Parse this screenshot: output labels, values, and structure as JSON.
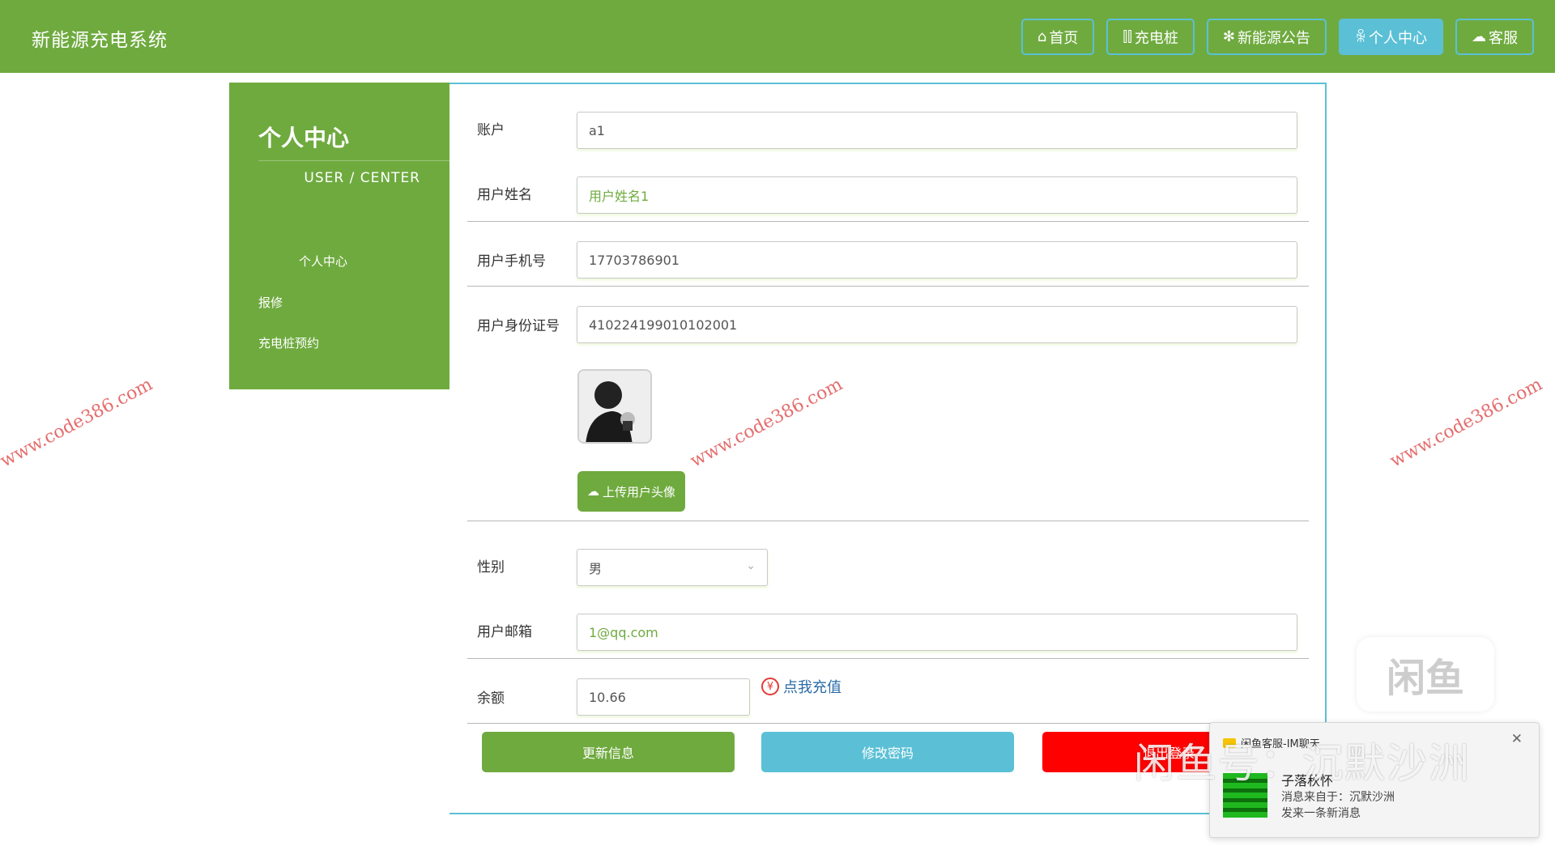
{
  "header": {
    "brand": "新能源充电系统",
    "nav": [
      {
        "icon": "⌂",
        "label": "首页",
        "active": false
      },
      {
        "icon": "⫿⫿",
        "label": "充电桩",
        "active": false
      },
      {
        "icon": "✻",
        "label": "新能源公告",
        "active": false
      },
      {
        "icon": "ꆜ",
        "label": "个人中心",
        "active": true
      },
      {
        "icon": "☁",
        "label": "客服",
        "active": false
      }
    ]
  },
  "sidebar": {
    "title": "个人中心",
    "subtitle": "USER / CENTER",
    "items": [
      "个人中心",
      "报修",
      "充电桩预约"
    ]
  },
  "form": {
    "account_label": "账户",
    "account_value": "a1",
    "name_label": "用户姓名",
    "name_value": "用户姓名1",
    "phone_label": "用户手机号",
    "phone_value": "17703786901",
    "idcard_label": "用户身份证号",
    "idcard_value": "410224199010102001",
    "upload_label": "上传用户头像",
    "gender_label": "性别",
    "gender_value": "男",
    "email_label": "用户邮箱",
    "email_value": "1@qq.com",
    "balance_label": "余额",
    "balance_value": "10.66",
    "recharge_label": "点我充值",
    "update_button": "更新信息",
    "password_button": "修改密码",
    "logout_button": "退出登录"
  },
  "watermarks": {
    "site": "www.code386.com",
    "overlay": "闲鱼号：沉默沙洲",
    "logo": "闲鱼"
  },
  "notification": {
    "app": "闲鱼客服-IM聊天",
    "title": "子落秋怀",
    "from": "消息来自于：沉默沙洲",
    "message": "发来一条新消息"
  },
  "colors": {
    "primary": "#6faa3f",
    "accent": "#5bc0d6",
    "danger": "#ff0000",
    "link": "#2a6ba8"
  }
}
